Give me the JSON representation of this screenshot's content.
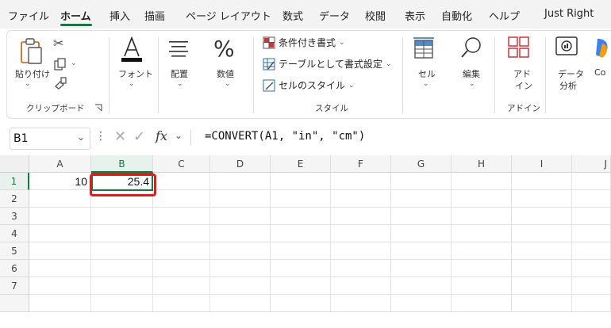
{
  "menu_tabs": [
    "ファイル",
    "ホーム",
    "挿入",
    "描画",
    "ページ レイアウト",
    "数式",
    "データ",
    "校閲",
    "表示",
    "自動化",
    "ヘルプ",
    "Just Right"
  ],
  "active_tab": "ホーム",
  "ribbon": {
    "clipboard": {
      "paste_label": "貼り付け",
      "group_label": "クリップボード"
    },
    "font": {
      "label": "フォント"
    },
    "alignment": {
      "label": "配置"
    },
    "number": {
      "label": "数値"
    },
    "styles": {
      "conditional": "条件付き書式",
      "as_table": "テーブルとして書式設定",
      "cell_styles": "セルのスタイル",
      "group_label": "スタイル"
    },
    "cells": {
      "label": "セル"
    },
    "editing": {
      "label": "編集"
    },
    "addins": {
      "label_line1": "アド",
      "label_line2": "イン",
      "group_label": "アドイン"
    },
    "analysis": {
      "label_line1": "データ",
      "label_line2": "分析"
    },
    "copilot": {
      "label": "Co"
    }
  },
  "formula_bar": {
    "name_box": "B1",
    "fx": "fx",
    "formula": "=CONVERT(A1, \"in\", \"cm\")"
  },
  "grid": {
    "columns": [
      "A",
      "B",
      "C",
      "D",
      "E",
      "F",
      "G",
      "H",
      "I",
      "J"
    ],
    "rows": [
      "1",
      "2",
      "3",
      "4",
      "5",
      "6",
      "7"
    ],
    "selected_column": "B",
    "selected_row": "1",
    "cells": {
      "A1": "10",
      "B1": "25.4"
    }
  },
  "colors": {
    "accent": "#107c41",
    "highlight": "#e21a1a"
  }
}
